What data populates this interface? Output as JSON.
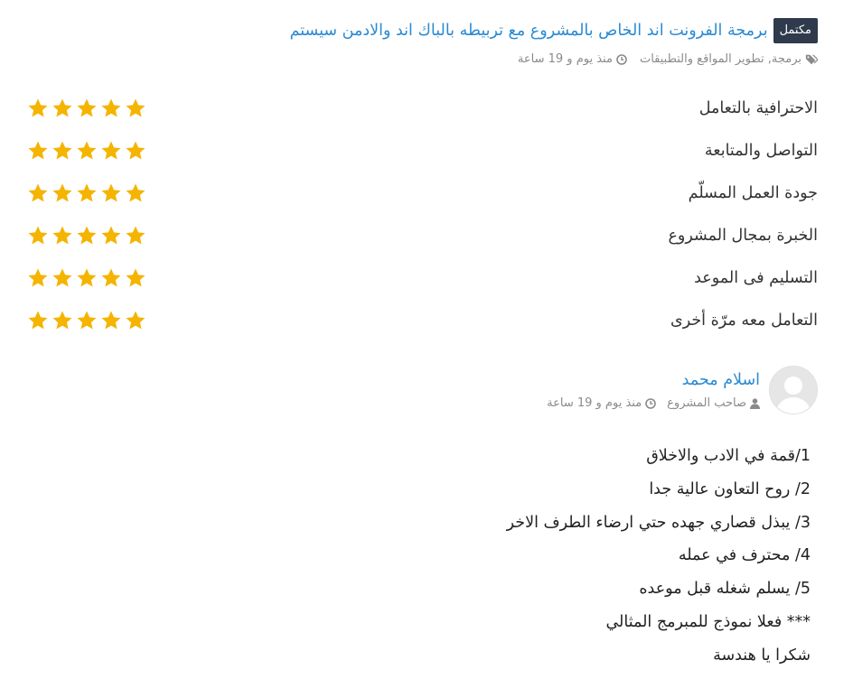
{
  "project": {
    "status_badge": "مكتمل",
    "title": "برمجة الفرونت اند الخاص بالمشروع مع تربيطه بالباك اند والادمن سيستم",
    "tags": "برمجة, تطوير المواقع والتطبيقات",
    "time_ago": "منذ يوم و 19 ساعة"
  },
  "ratings": [
    {
      "label": "الاحترافية بالتعامل",
      "stars": 5
    },
    {
      "label": "التواصل والمتابعة",
      "stars": 5
    },
    {
      "label": "جودة العمل المسلّم",
      "stars": 5
    },
    {
      "label": "الخبرة بمجال المشروع",
      "stars": 5
    },
    {
      "label": "التسليم فى الموعد",
      "stars": 5
    },
    {
      "label": "التعامل معه مرّة أخرى",
      "stars": 5
    }
  ],
  "reviewer": {
    "name": "اسلام محمد",
    "role": "صاحب المشروع",
    "time_ago": "منذ يوم و 19 ساعة"
  },
  "comment_lines": [
    "1/قمة في الادب والاخلاق",
    "2/ روح التعاون عالية جدا",
    "3/ يبذل قصاري جهده حتي ارضاء الطرف الاخر",
    "4/ محترف في عمله",
    "5/ يسلم شغله قبل موعده",
    "*** فعلا نموذج للمبرمج المثالي",
    "شكرا يا هندسة"
  ],
  "colors": {
    "link": "#2a8ad2",
    "badge_bg": "#2f3b4c",
    "star": "#f5b400",
    "meta": "#8a8a8a"
  }
}
